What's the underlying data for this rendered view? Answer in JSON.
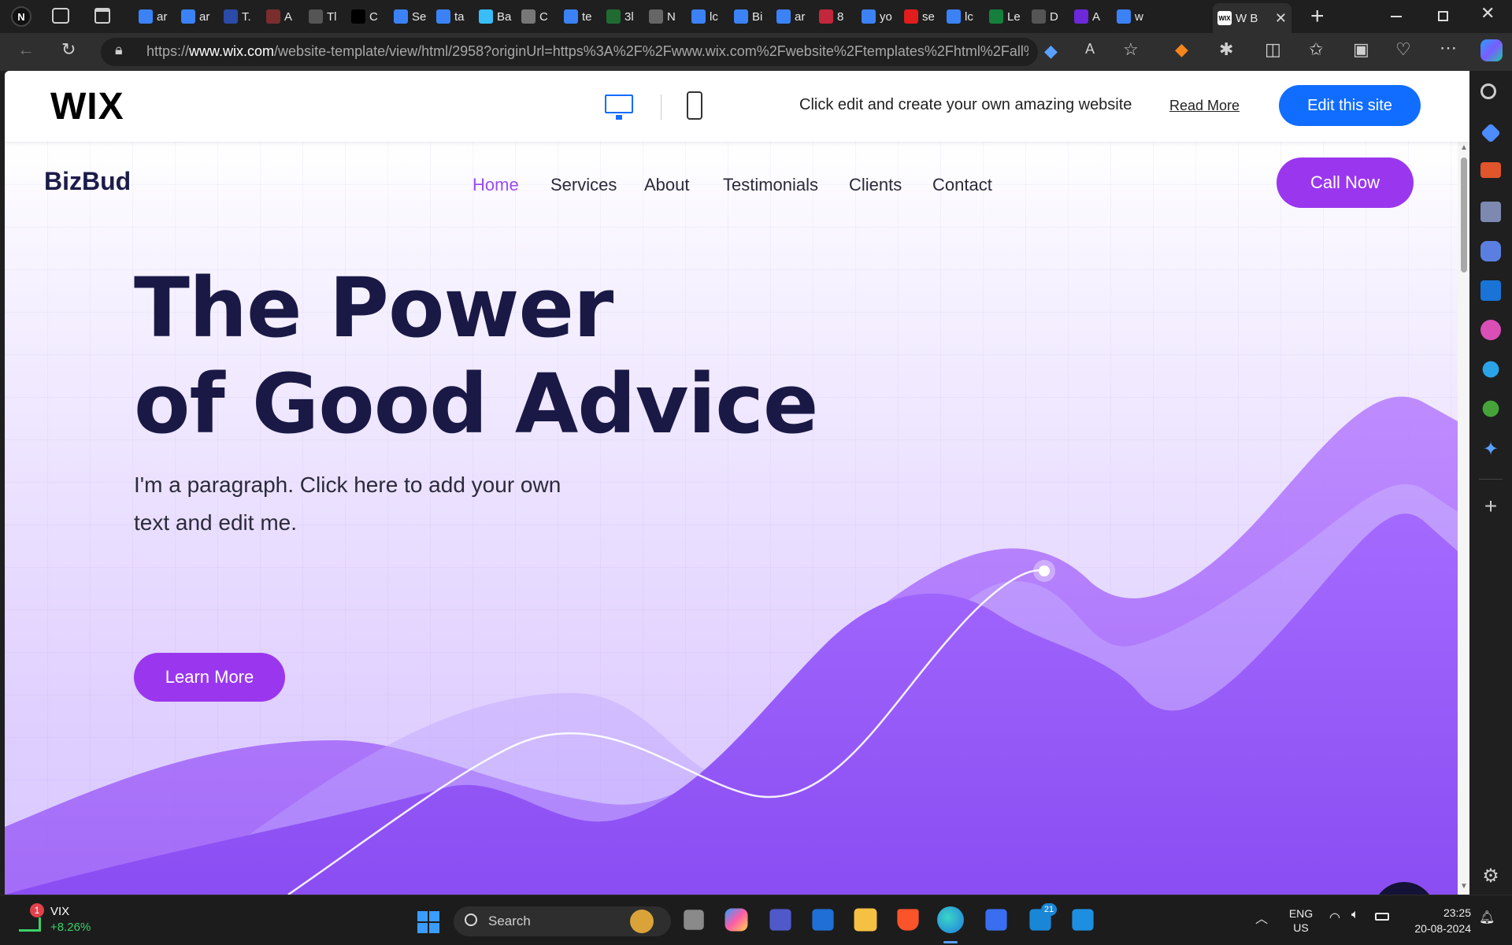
{
  "browser": {
    "tabs": [
      {
        "label": "ar",
        "icon": "search-icon",
        "color": "#3b82f6"
      },
      {
        "label": "ar",
        "icon": "search-icon",
        "color": "#3b82f6"
      },
      {
        "label": "T.",
        "icon": "w-logo-icon",
        "color": "#2b4ba8"
      },
      {
        "label": "A",
        "icon": "spark-icon",
        "color": "#7a2d2d"
      },
      {
        "label": "Tl",
        "icon": "wix-icon",
        "color": "#555555"
      },
      {
        "label": "C",
        "icon": "triangle-icon",
        "color": "#000000"
      },
      {
        "label": "Se",
        "icon": "search-icon",
        "color": "#3b82f6"
      },
      {
        "label": "ta",
        "icon": "search-icon",
        "color": "#3b82f6"
      },
      {
        "label": "Ba",
        "icon": "wave-icon",
        "color": "#38bdf8"
      },
      {
        "label": "C",
        "icon": "openai-icon",
        "color": "#777777"
      },
      {
        "label": "te",
        "icon": "search-icon",
        "color": "#3b82f6"
      },
      {
        "label": "3l",
        "icon": "px-icon",
        "color": "#1f6b32"
      },
      {
        "label": "N",
        "icon": "grid-icon",
        "color": "#666666"
      },
      {
        "label": "lc",
        "icon": "search-icon",
        "color": "#3b82f6"
      },
      {
        "label": "Bi",
        "icon": "search-icon",
        "color": "#3b82f6"
      },
      {
        "label": "ar",
        "icon": "search-icon",
        "color": "#3b82f6"
      },
      {
        "label": "8",
        "icon": "mail-icon",
        "color": "#c2273b"
      },
      {
        "label": "yo",
        "icon": "search-icon",
        "color": "#3b82f6"
      },
      {
        "label": "se",
        "icon": "youtube-icon",
        "color": "#e11d1d"
      },
      {
        "label": "lc",
        "icon": "search-icon",
        "color": "#3b82f6"
      },
      {
        "label": "Le",
        "icon": "leaf-icon",
        "color": "#15803d"
      },
      {
        "label": "D",
        "icon": "doc-icon",
        "color": "#555555"
      },
      {
        "label": "A",
        "icon": "wp-icon",
        "color": "#6d28d9"
      },
      {
        "label": "w",
        "icon": "search-icon",
        "color": "#3b82f6"
      }
    ],
    "active_tab": {
      "label": "W B",
      "icon": "wix-icon"
    },
    "url_prefix": "https://",
    "url_host": "www.wix.com",
    "url_rest": "/website-template/view/html/2958?originUrl=https%3A%2F%2Fwww.wix.com%2Fwebsite%2Ftemplates%2Fhtml%2Fall%2F..."
  },
  "wixbar": {
    "logo": "WIX",
    "message": "Click edit and create your own amazing website",
    "read_more": "Read More",
    "edit_button": "Edit this site"
  },
  "site": {
    "brand": "BizBud",
    "nav": [
      "Home",
      "Services",
      "About",
      "Testimonials",
      "Clients",
      "Contact"
    ],
    "active_nav": "Home",
    "call_button": "Call Now",
    "headline_line1": "The Power",
    "headline_line2": "of Good Advice",
    "paragraph": "I'm a paragraph. Click here to add your own text and edit me.",
    "learn_more": "Learn More",
    "accent_color": "#9a37ee",
    "headline_color": "#1a1946"
  },
  "taskbar": {
    "stock_symbol": "VIX",
    "stock_change": "+8.26%",
    "stock_badge": "1",
    "search_placeholder": "Search",
    "store_badge": "21",
    "lang": "ENG",
    "region": "US",
    "time": "23:25",
    "date": "20-08-2024"
  }
}
